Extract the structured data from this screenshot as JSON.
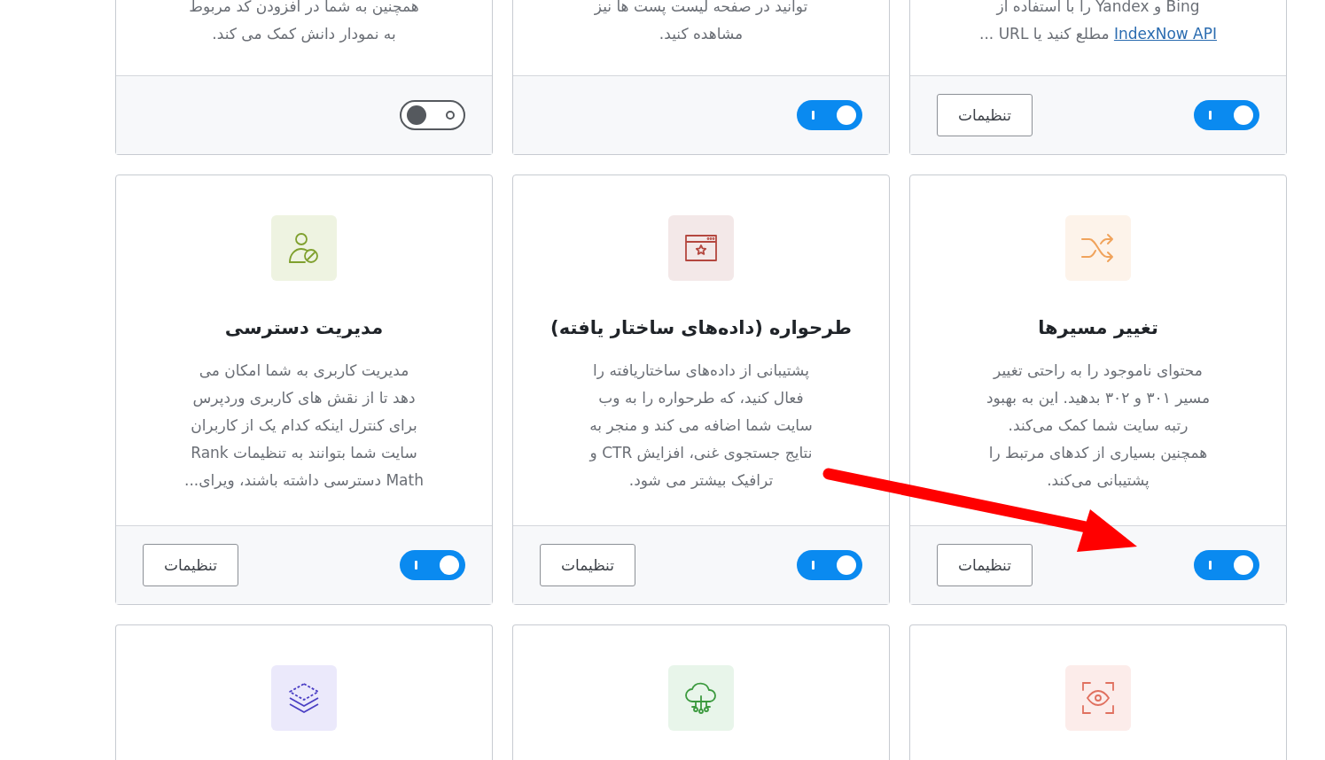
{
  "rows": [
    {
      "cards": [
        {
          "description": [
            {
              "kind": "text",
              "text": "Bing و Yandex را با استفاده از\n"
            },
            {
              "kind": "link",
              "text": "IndexNow API"
            },
            {
              "kind": "text",
              "text": " مطلع کنید یا URL ..."
            }
          ],
          "enabled": true,
          "settings_button": "تنظیمات"
        },
        {
          "description": [
            {
              "kind": "text",
              "text": "توانید در صفحه لیست پست ها نیز\nمشاهده کنید."
            }
          ],
          "enabled": true
        },
        {
          "description": [
            {
              "kind": "text",
              "text": "همچنین به شما در افزودن کد مربوط\nبه نمودار دانش کمک می کند."
            }
          ],
          "enabled": false
        }
      ]
    },
    {
      "cards": [
        {
          "title": "تغییر مسیرها",
          "description": [
            {
              "kind": "text",
              "text": "محتوای ناموجود را به راحتی تغییر\nمسیر ۳۰۱ و ۳۰۲ بدهید. این به بهبود\nرتبه سایت شما کمک می‌کند.\nهمچنین بسیاری از کدهای مرتبط را\nپشتیبانی می‌کند."
            }
          ],
          "enabled": true,
          "settings_button": "تنظیمات"
        },
        {
          "title": "طرحواره (داده‌های ساختار یافته)",
          "description": [
            {
              "kind": "text",
              "text": "پشتیبانی از داده‌های ساختاریافته را\nفعال کنید، که طرحواره را به وب\nسایت شما اضافه می کند و منجر به\nنتایج جستجوی غنی، افزایش CTR و\nترافیک بیشتر می شود."
            }
          ],
          "enabled": true,
          "settings_button": "تنظیمات"
        },
        {
          "title": "مدیریت دسترسی",
          "description": [
            {
              "kind": "text",
              "text": "مدیریت کاربری به شما امکان می\nدهد تا از نقش های کاربری وردپرس\nبرای کنترل اینکه کدام یک از کاربران\nسایت شما بتوانند به تنظیمات Rank\nMath دسترسی داشته باشند، ویرای..."
            }
          ],
          "enabled": true,
          "settings_button": "تنظیمات"
        }
      ]
    },
    {
      "cards": [
        {
          "kind": "icon-only"
        },
        {
          "kind": "icon-only"
        },
        {
          "kind": "icon-only"
        }
      ]
    }
  ]
}
